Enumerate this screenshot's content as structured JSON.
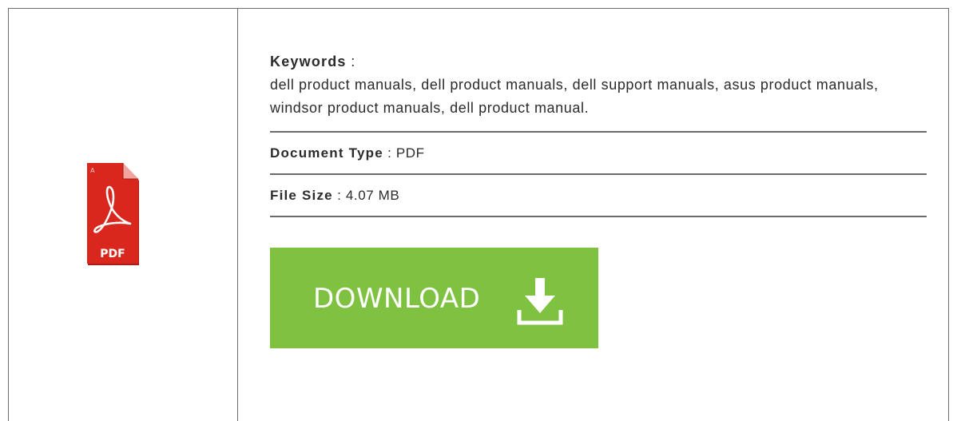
{
  "icon": {
    "name": "pdf-file-icon",
    "label": "PDF",
    "color": "#d9271e"
  },
  "keywords": {
    "label": "Keywords",
    "separator": " : ",
    "value": "dell product manuals, dell product manuals, dell support manuals, asus product manuals, windsor product manuals, dell product manual."
  },
  "document_type": {
    "label": "Document Type",
    "separator": " : ",
    "value": "PDF"
  },
  "file_size": {
    "label": "File Size",
    "separator": " : ",
    "value": "4.07 MB"
  },
  "download": {
    "label": "DOWNLOAD",
    "icon": "download-arrow-icon",
    "color": "#7fc241"
  }
}
